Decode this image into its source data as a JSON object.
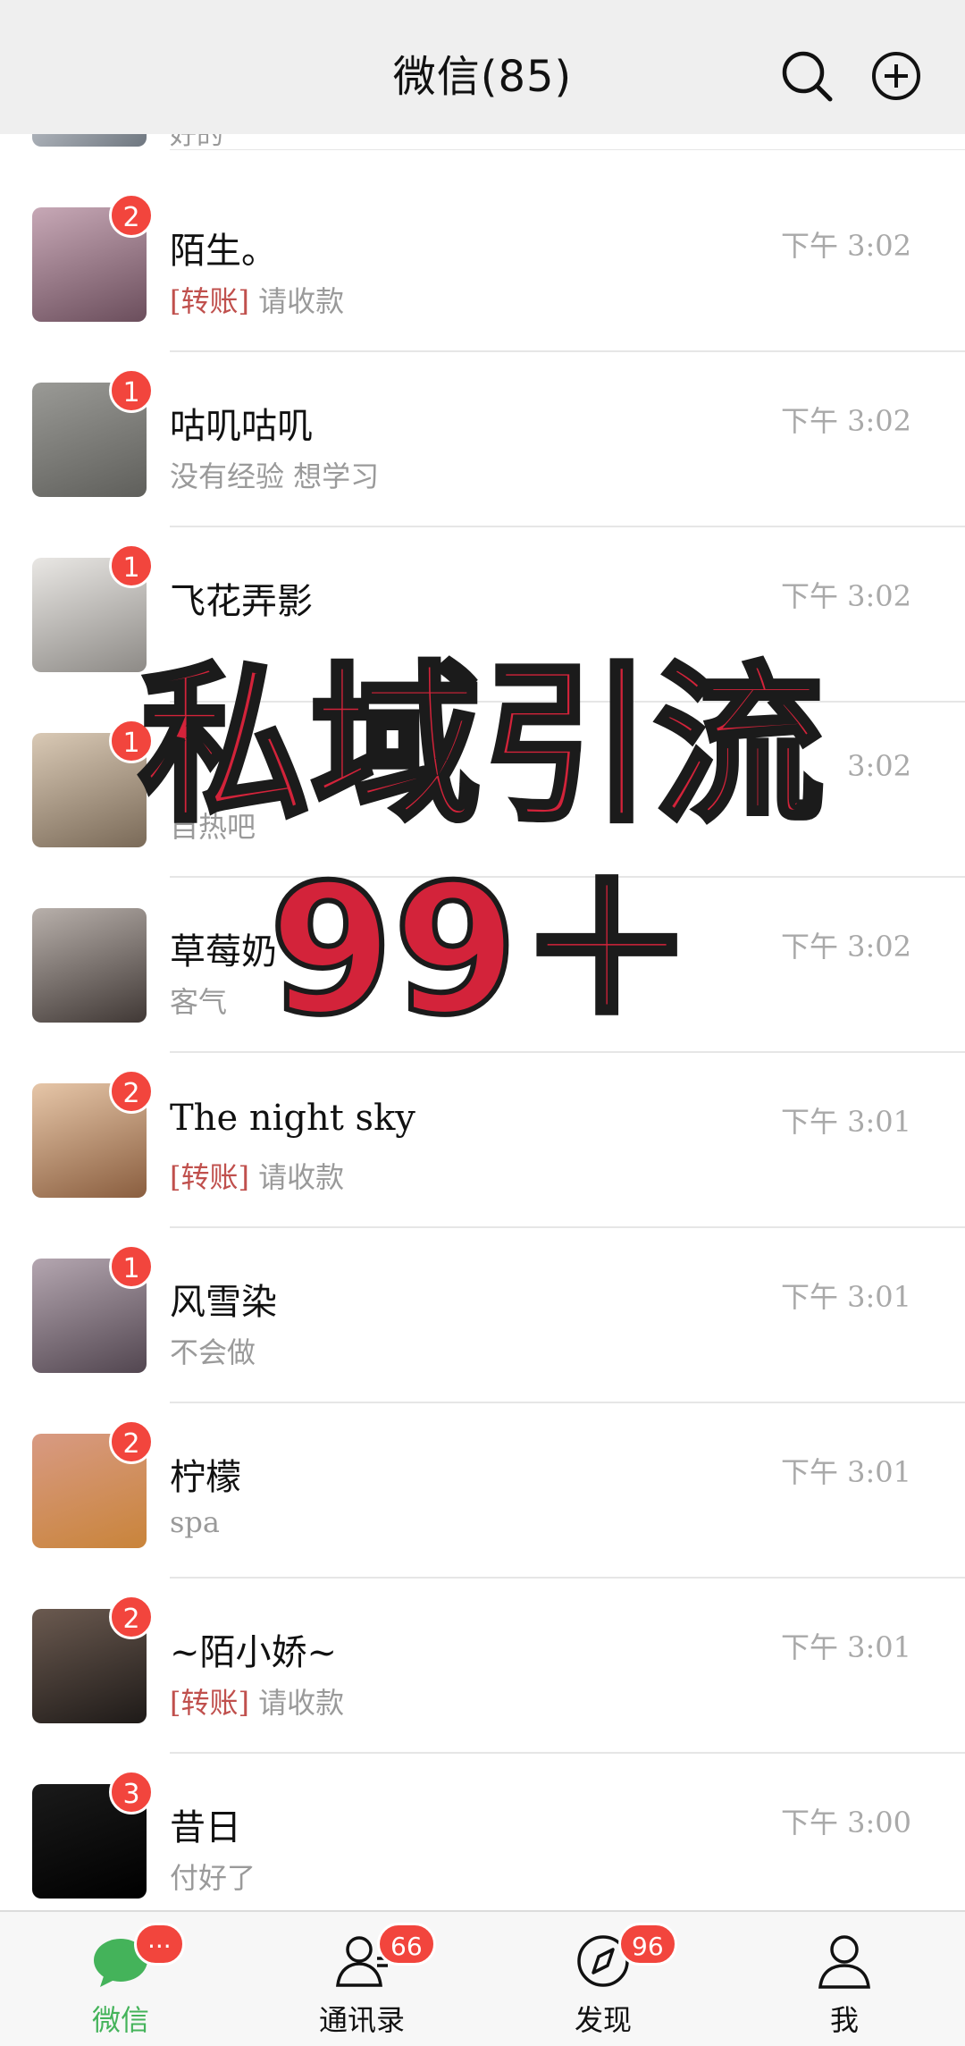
{
  "header": {
    "title": "微信(85)"
  },
  "partial_row": {
    "preview": "好的"
  },
  "chats": [
    {
      "name": "陌生。",
      "tag": "[转账]",
      "preview": " 请收款",
      "time": "下午 3:02",
      "badge": "2",
      "avatar_colors": [
        "#c7a8b6",
        "#6b4e5c"
      ]
    },
    {
      "name": "咕叽咕叽",
      "tag": "",
      "preview": "没有经验 想学习",
      "time": "下午 3:02",
      "badge": "1",
      "avatar_colors": [
        "#9a9a96",
        "#5f5f5b"
      ]
    },
    {
      "name": "飞花弄影",
      "tag": "",
      "preview": "",
      "time": "下午 3:02",
      "badge": "1",
      "avatar_colors": [
        "#e9e7e4",
        "#8d8a86"
      ]
    },
    {
      "name": "",
      "tag": "",
      "preview": "自热吧",
      "time": "3:02",
      "badge": "1",
      "avatar_colors": [
        "#d9c9b5",
        "#7a6a58"
      ]
    },
    {
      "name": "草莓奶",
      "tag": "",
      "preview": "客气",
      "time": "下午 3:02",
      "badge": "",
      "avatar_colors": [
        "#b8b0ab",
        "#403835"
      ]
    },
    {
      "name": "The night sky",
      "tag": "[转账]",
      "preview": " 请收款",
      "time": "下午 3:01",
      "badge": "2",
      "avatar_colors": [
        "#e6c6a8",
        "#8a5e3f"
      ]
    },
    {
      "name": "风雪染",
      "tag": "",
      "preview": "不会做",
      "time": "下午 3:01",
      "badge": "1",
      "avatar_colors": [
        "#b4a6b0",
        "#524650"
      ]
    },
    {
      "name": "柠檬",
      "tag": "",
      "preview": "spa",
      "time": "下午 3:01",
      "badge": "2",
      "avatar_colors": [
        "#d89a83",
        "#c9843a"
      ]
    },
    {
      "name": "~陌小娇~",
      "tag": "[转账]",
      "preview": " 请收款",
      "time": "下午 3:01",
      "badge": "2",
      "avatar_colors": [
        "#6b5a50",
        "#1e1a18"
      ]
    },
    {
      "name": "昔日",
      "tag": "",
      "preview": "付好了",
      "time": "下午 3:00",
      "badge": "3",
      "avatar_colors": [
        "#1a1a1a",
        "#000000"
      ]
    }
  ],
  "overlay": {
    "line1": "私域引流",
    "line2": "99＋"
  },
  "tabbar": {
    "tabs": [
      {
        "label": "微信",
        "badge": "···"
      },
      {
        "label": "通讯录",
        "badge": "66"
      },
      {
        "label": "发现",
        "badge": "96"
      },
      {
        "label": "我",
        "badge": ""
      }
    ]
  },
  "colors": {
    "accent_green": "#44b35a",
    "badge_red": "#f2453d",
    "overlay_red": "#d3233a"
  }
}
